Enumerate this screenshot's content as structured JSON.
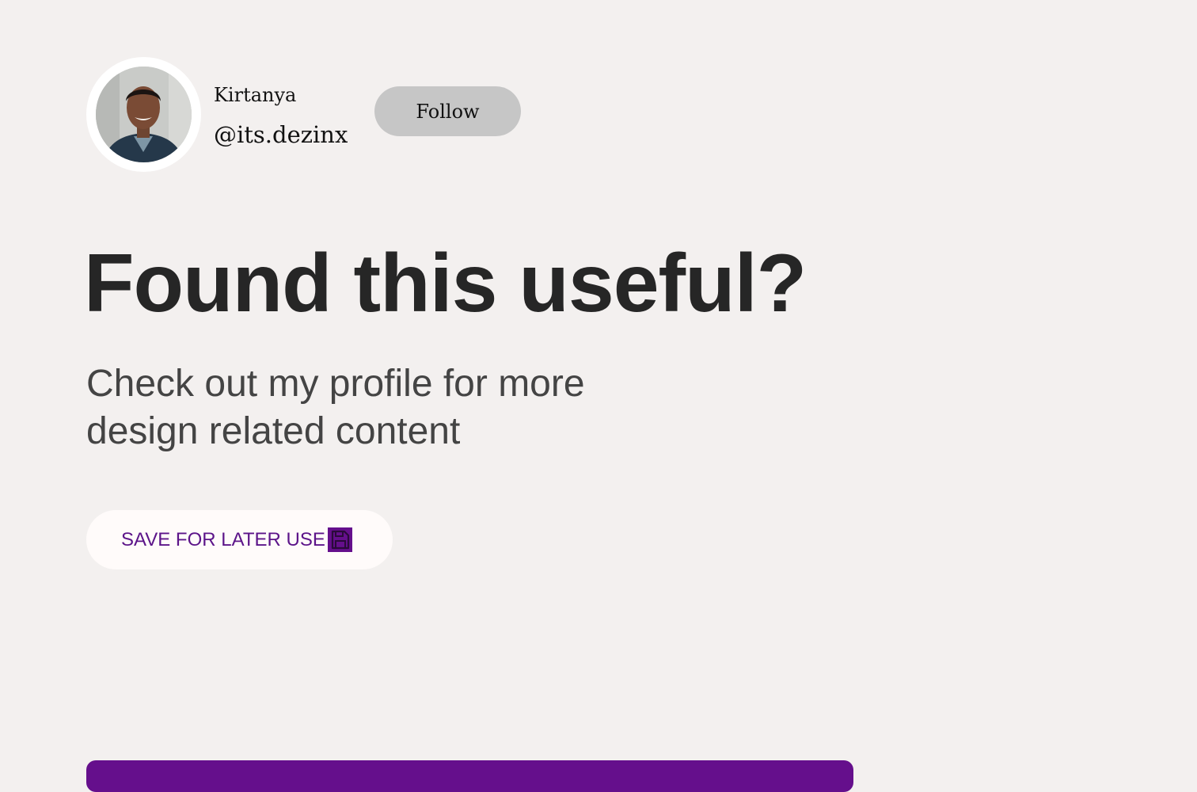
{
  "profile": {
    "name": "Kirtanya",
    "handle": "@its.dezinx",
    "follow_label": "Follow"
  },
  "main": {
    "headline": "Found this useful?",
    "subtext": "Check out my profile for more design related content",
    "save_label": "SAVE FOR LATER USE",
    "save_icon": "floppy-disk-icon"
  },
  "colors": {
    "background": "#f3f0ef",
    "accent": "#650f8c",
    "accent_text": "#5c1489",
    "follow_button": "#c6c6c6"
  }
}
